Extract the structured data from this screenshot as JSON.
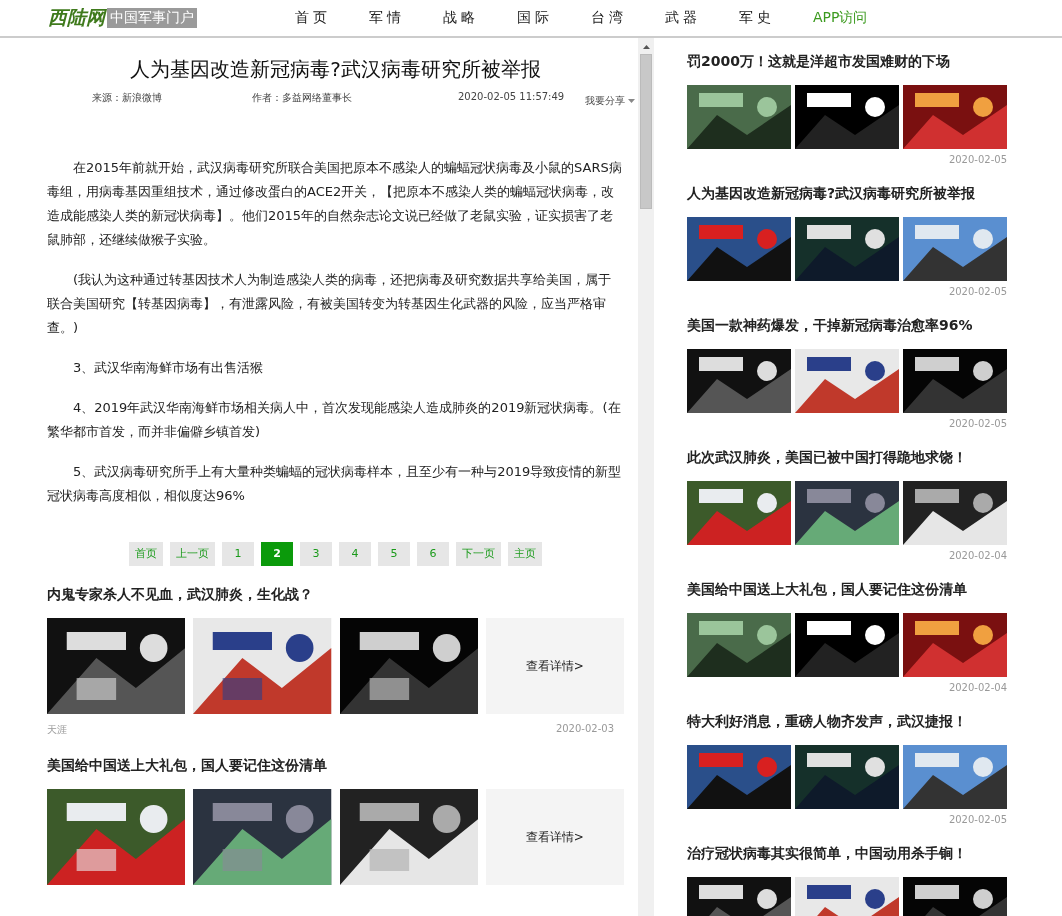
{
  "header": {
    "logo": "西陆网",
    "tagline": "中国军事门户",
    "nav": [
      {
        "label": "首 页",
        "kind": "plain"
      },
      {
        "label": "军 情",
        "kind": "plain"
      },
      {
        "label": "战 略",
        "kind": "plain"
      },
      {
        "label": "国 际",
        "kind": "plain"
      },
      {
        "label": "台 湾",
        "kind": "plain"
      },
      {
        "label": "武 器",
        "kind": "plain"
      },
      {
        "label": "军 史",
        "kind": "plain"
      },
      {
        "label": "APP访问",
        "kind": "app"
      }
    ]
  },
  "article": {
    "title": "人为基因改造新冠病毒?武汉病毒研究所被举报",
    "source": "来源：新浪微博",
    "author": "作者：多益网络董事长",
    "time": "2020-02-05 11:57:49",
    "share": "我要分享",
    "paragraphs": [
      "在2015年前就开始，武汉病毒研究所联合美国把原本不感染人的蝙蝠冠状病毒及小鼠的SARS病毒组，用病毒基因重组技术，通过修改蛋白的ACE2开关，【把原本不感染人类的蝙蝠冠状病毒，改造成能感染人类的新冠状病毒】。他们2015年的自然杂志论文说已经做了老鼠实验，证实损害了老鼠肺部，还继续做猴子实验。",
      "(我认为这种通过转基因技术人为制造感染人类的病毒，还把病毒及研究数据共享给美国，属于联合美国研究【转基因病毒】，有泄露风险，有被美国转变为转基因生化武器的风险，应当严格审查。)",
      "3、武汉华南海鲜市场有出售活猴",
      "4、2019年武汉华南海鲜市场相关病人中，首次发现能感染人造成肺炎的2019新冠状病毒。(在繁华都市首发，而并非偏僻乡镇首发)",
      "5、武汉病毒研究所手上有大量种类蝙蝠的冠状病毒样本，且至少有一种与2019导致疫情的新型冠状病毒高度相似，相似度达96%"
    ],
    "pagination": [
      {
        "label": "首页",
        "selected": false
      },
      {
        "label": "上一页",
        "selected": false
      },
      {
        "label": "1",
        "selected": false
      },
      {
        "label": "2",
        "selected": true
      },
      {
        "label": "3",
        "selected": false
      },
      {
        "label": "4",
        "selected": false
      },
      {
        "label": "5",
        "selected": false
      },
      {
        "label": "6",
        "selected": false
      },
      {
        "label": "下一页",
        "selected": false
      },
      {
        "label": "主页",
        "selected": false
      }
    ]
  },
  "related": [
    {
      "title": "内鬼专家杀人不见血，武汉肺炎，生化战？",
      "more": "查看详情>",
      "source": "天涯",
      "date": "2020-02-03"
    },
    {
      "title": "美国给中国送上大礼包，国人要记住这份清单",
      "more": "查看详情>"
    }
  ],
  "sidebar": [
    {
      "title": "罚2000万！这就是洋超市发国难财的下场",
      "date": "2020-02-05"
    },
    {
      "title": "人为基因改造新冠病毒?武汉病毒研究所被举报",
      "date": "2020-02-05"
    },
    {
      "title": "美国一款神药爆发，干掉新冠病毒治愈率96%",
      "date": "2020-02-05"
    },
    {
      "title": "此次武汉肺炎，美国已被中国打得跪地求饶！",
      "date": "2020-02-04"
    },
    {
      "title": "美国给中国送上大礼包，国人要记住这份清单",
      "date": "2020-02-04"
    },
    {
      "title": "特大利好消息，重磅人物齐发声，武汉捷报！",
      "date": "2020-02-05"
    },
    {
      "title": "治疗冠状病毒其实很简单，中国动用杀手锏！"
    }
  ]
}
